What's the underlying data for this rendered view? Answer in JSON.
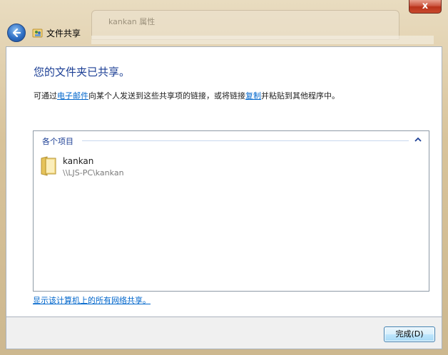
{
  "window": {
    "title": "文件共享",
    "close_glyph": "x",
    "background_window_title": "kankan 属性"
  },
  "main": {
    "heading": "您的文件夹已共享。",
    "desc_pre": "可通过",
    "desc_link_email": "电子邮件",
    "desc_mid": "向某个人发送到这些共享项的链接，或将链接",
    "desc_link_copy": "复制",
    "desc_post": "并粘贴到其他程序中。"
  },
  "list": {
    "group_label": "各个项目",
    "items": [
      {
        "name": "kankan",
        "path": "\\\\LJS-PC\\kankan"
      }
    ]
  },
  "footer": {
    "show_all_link": "显示该计算机上的所有网络共享。",
    "finish_label": "完成(D)"
  },
  "colors": {
    "heading": "#1c3f95",
    "link": "#0066cc",
    "close_red": "#c9503a"
  }
}
